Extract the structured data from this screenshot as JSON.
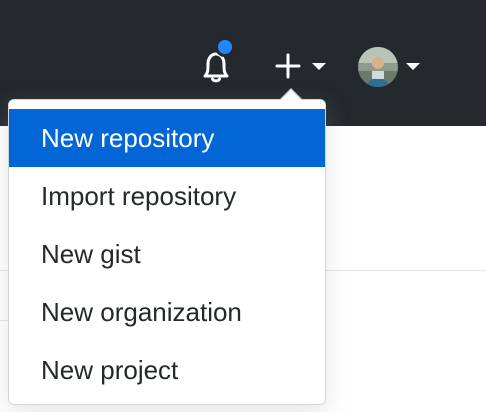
{
  "header": {
    "notifications": {
      "icon": "bell-icon",
      "has_unread": true
    },
    "create_button": {
      "icon": "plus-icon"
    },
    "profile": {
      "icon": "avatar"
    }
  },
  "create_menu": {
    "items": [
      {
        "label": "New repository",
        "active": true
      },
      {
        "label": "Import repository",
        "active": false
      },
      {
        "label": "New gist",
        "active": false
      },
      {
        "label": "New organization",
        "active": false
      },
      {
        "label": "New project",
        "active": false
      }
    ]
  },
  "colors": {
    "header_bg": "#24292e",
    "accent": "#0366d6",
    "unread_dot": "#2188ff",
    "menu_text": "#24292e"
  }
}
